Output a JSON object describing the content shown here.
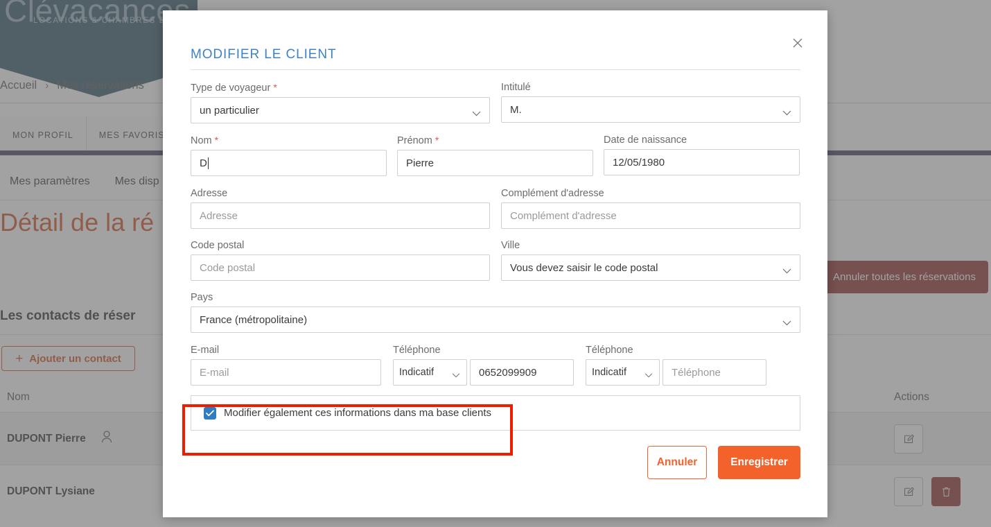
{
  "background": {
    "brand": {
      "wordmark": "Clévacances",
      "tagline": "LOCATIONS & CHAMBRES D'HÔTES"
    },
    "breadcrumb": {
      "home": "Accueil",
      "separator": "›",
      "current": "Mes réservations"
    },
    "tabs": [
      {
        "label": "MON PROFIL"
      },
      {
        "label": "MES FAVORIS"
      }
    ],
    "subnav": [
      {
        "label": "Mes paramètres"
      },
      {
        "label": "Mes disp"
      }
    ],
    "page_title": "Détail de la ré",
    "cancel_all_button": "Annuler toutes les réservations",
    "contacts_heading": "Les contacts de réser",
    "add_contact_button": "Ajouter un contact",
    "table": {
      "columns": {
        "name": "Nom",
        "actions": "Actions"
      },
      "rows": [
        {
          "name": "DUPONT Pierre",
          "has_person_icon": true,
          "edit": "edit-icon",
          "delete": null
        },
        {
          "name": "DUPONT Lysiane",
          "has_person_icon": false,
          "edit": "edit-icon",
          "delete": "trash-icon"
        }
      ]
    }
  },
  "modal": {
    "title": "MODIFIER LE CLIENT",
    "close_icon": "close-icon",
    "fields": {
      "type_voyageur": {
        "label": "Type de voyageur",
        "required": true,
        "value": "un particulier"
      },
      "intitule": {
        "label": "Intitulé",
        "required": false,
        "value": "M."
      },
      "nom": {
        "label": "Nom",
        "required": true,
        "value": "D"
      },
      "prenom": {
        "label": "Prénom",
        "required": true,
        "value": "Pierre"
      },
      "date_naissance": {
        "label": "Date de naissance",
        "required": false,
        "value": "12/05/1980"
      },
      "adresse": {
        "label": "Adresse",
        "required": false,
        "value": "",
        "placeholder": "Adresse"
      },
      "complement": {
        "label": "Complément d'adresse",
        "required": false,
        "value": "",
        "placeholder": "Complément d'adresse"
      },
      "code_postal": {
        "label": "Code postal",
        "required": false,
        "value": "",
        "placeholder": "Code postal"
      },
      "ville": {
        "label": "Ville",
        "required": false,
        "value": "Vous devez saisir le code postal"
      },
      "pays": {
        "label": "Pays",
        "required": false,
        "value": "France (métropolitaine)"
      },
      "email": {
        "label": "E-mail",
        "required": false,
        "value": "",
        "placeholder": "E-mail"
      },
      "telephone1": {
        "label": "Téléphone",
        "indicatif": "Indicatif",
        "value": "0652099909"
      },
      "telephone2": {
        "label": "Téléphone",
        "indicatif": "Indicatif",
        "value": "",
        "placeholder": "Téléphone"
      }
    },
    "checkbox": {
      "label": "Modifier également ces informations dans ma base clients",
      "checked": true
    },
    "buttons": {
      "cancel": "Annuler",
      "save": "Enregistrer"
    }
  },
  "colors": {
    "accent_orange": "#F4622C",
    "title_blue": "#3F82C4",
    "brand_teal": "#4C6D7D",
    "checkbox_blue": "#2E7CC4",
    "annotation_red": "#EE1D00",
    "danger_red": "#A04A4A"
  }
}
